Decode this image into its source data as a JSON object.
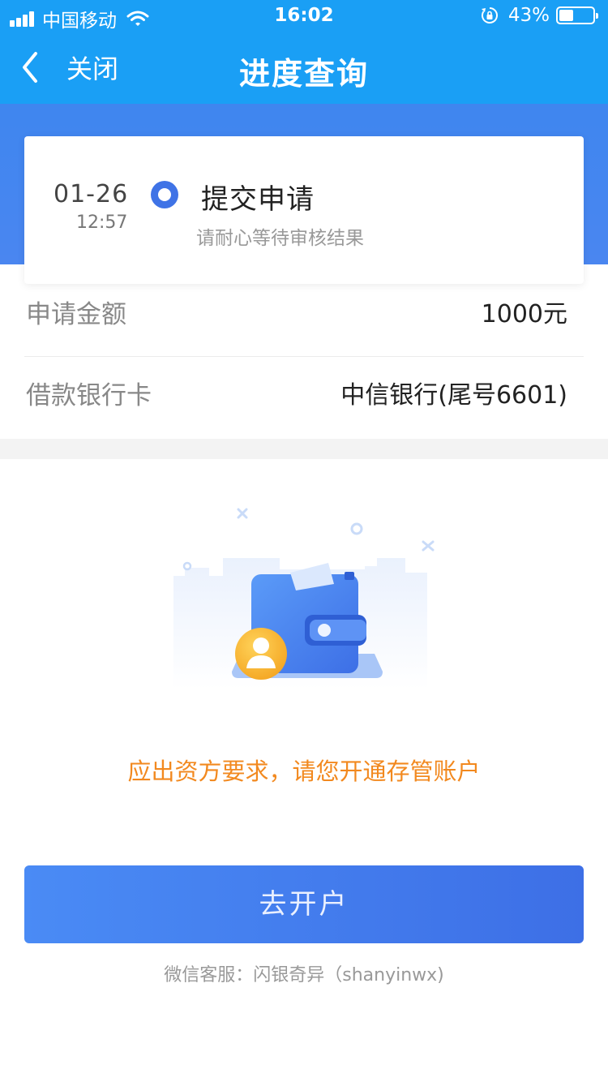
{
  "status_bar": {
    "carrier": "中国移动",
    "time": "16:02",
    "battery_percent": "43%",
    "battery_level": 0.43
  },
  "nav": {
    "back_label": "关闭",
    "title": "进度查询"
  },
  "progress": {
    "date": "01-26",
    "time": "12:57",
    "step_title": "提交申请",
    "step_desc": "请耐心等待审核结果"
  },
  "details": {
    "amount_label": "申请金额",
    "amount_value": "1000元",
    "card_label": "借款银行卡",
    "card_value": "中信银行(尾号6601)"
  },
  "notice": "应出资方要求，请您开通存管账户",
  "open_account_button": "去开户",
  "support_text": "微信客服：闪银奇异（shanyinwx)",
  "colors": {
    "header_blue": "#1a9ff5",
    "band_blue": "#3f86ef",
    "accent_blue": "#3f73e6",
    "notice_orange": "#f2891f"
  }
}
